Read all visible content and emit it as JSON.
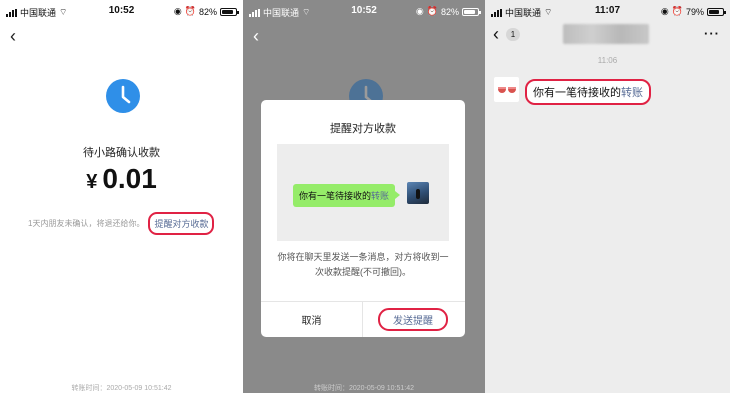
{
  "status": {
    "carrier": "中国联通",
    "panel1_time": "10:52",
    "panel1_battery": "82%",
    "panel2_time": "10:52",
    "panel2_battery": "82%",
    "panel3_time": "11:07",
    "panel3_battery": "79%",
    "battery_level_1": 0.82,
    "battery_level_3": 0.79
  },
  "panel1": {
    "status_text": "待小路确认收款",
    "currency": "¥",
    "amount": "0.01",
    "hint": "1天内朋友未确认，将退还给你。",
    "remind_link": "提醒对方收款",
    "transfer_time": "转账时间：2020-05-09 10:51:42"
  },
  "panel2": {
    "dialog_title": "提醒对方收款",
    "bubble_prefix": "你有一笔待接收的",
    "bubble_highlight": "转账",
    "description": "你将在聊天里发送一条消息，对方将收到一次收款提醒(不可撤回)。",
    "cancel_label": "取消",
    "send_label": "发送提醒",
    "transfer_time": "转账时间：2020-05-09 10:51:42"
  },
  "panel3": {
    "unread_count": "1",
    "more_label": "···",
    "timestamp": "11:06",
    "msg_prefix": "你有一笔待接收的",
    "msg_highlight": "转账"
  },
  "colors": {
    "accent_blue": "#2f8fe8",
    "link": "#576b95",
    "highlight_outline": "#e02244",
    "bubble_green": "#95ec69"
  },
  "icons": [
    "back-chevron-icon",
    "clock-icon",
    "wifi-icon",
    "signal-icon",
    "battery-icon",
    "more-icon"
  ]
}
